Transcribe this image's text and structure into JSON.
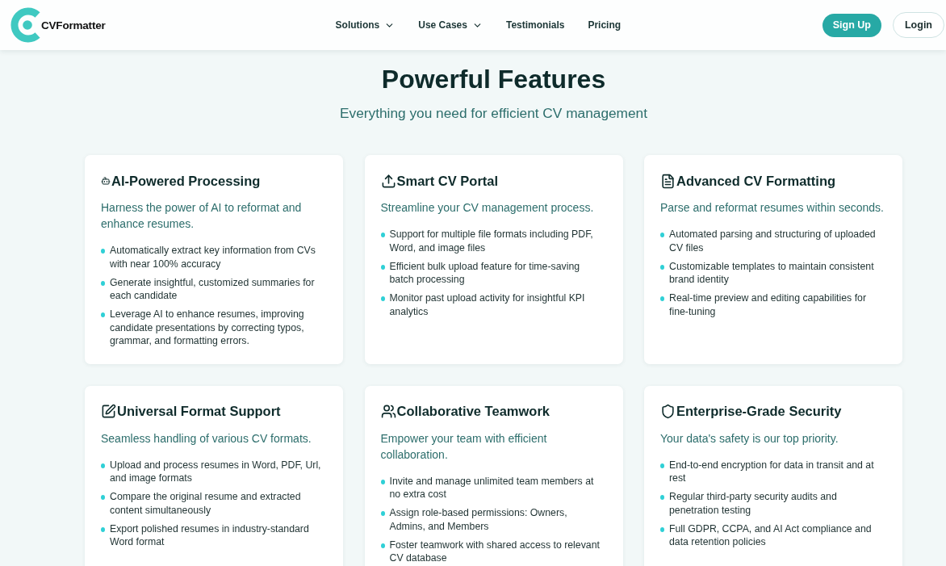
{
  "header": {
    "brand": "CVFormatter",
    "nav": [
      {
        "label": "Solutions",
        "has_menu": true
      },
      {
        "label": "Use Cases",
        "has_menu": true
      },
      {
        "label": "Testimonials",
        "has_menu": false
      },
      {
        "label": "Pricing",
        "has_menu": false
      }
    ],
    "buttons": [
      {
        "label": "Sign Up",
        "kind": "primary"
      },
      {
        "label": "Login",
        "kind": "outline"
      }
    ]
  },
  "features": {
    "title": "Powerful Features",
    "subtitle": "Everything you need for efficient CV management",
    "cards": [
      {
        "title": "AI-Powered Processing",
        "description": "Harness the power of AI to reformat and enhance resumes.",
        "points": [
          "Automatically extract key information from CVs with near 100% accuracy",
          "Generate insightful, customized summaries for each candidate",
          "Leverage AI to enhance resumes, improving candidate presentations by correcting typos, grammar, and formatting errors."
        ]
      },
      {
        "title": "Smart CV Portal",
        "description": "Streamline your CV management process.",
        "points": [
          "Support for multiple file formats including PDF, Word, and image files",
          "Efficient bulk upload feature for time-saving batch processing",
          "Monitor past upload activity for insightful KPI analytics"
        ]
      },
      {
        "title": "Advanced CV Formatting",
        "description": "Parse and reformat resumes within seconds.",
        "points": [
          "Automated parsing and structuring of uploaded CV files",
          "Customizable templates to maintain consistent brand identity",
          "Real-time preview and editing capabilities for fine-tuning"
        ]
      },
      {
        "title": "Universal Format Support",
        "description": "Seamless handling of various CV formats.",
        "points": [
          "Upload and process resumes in Word, PDF, Url, and image formats",
          "Compare the original resume and extracted content simultaneously",
          "Export polished resumes in industry-standard Word format"
        ]
      },
      {
        "title": "Collaborative Teamwork",
        "description": "Empower your team with efficient collaboration.",
        "points": [
          "Invite and manage unlimited team members at no extra cost",
          "Assign role-based permissions: Owners, Admins, and Members",
          "Foster teamwork with shared access to relevant CV database"
        ]
      },
      {
        "title": "Enterprise-Grade Security",
        "description": "Your data's safety is our top priority.",
        "points": [
          "End-to-end encryption for data in transit and at rest",
          "Regular third-party security audits and penetration testing",
          "Full GDPR, CCPA, and AI Act compliance and data retention policies"
        ]
      }
    ]
  }
}
